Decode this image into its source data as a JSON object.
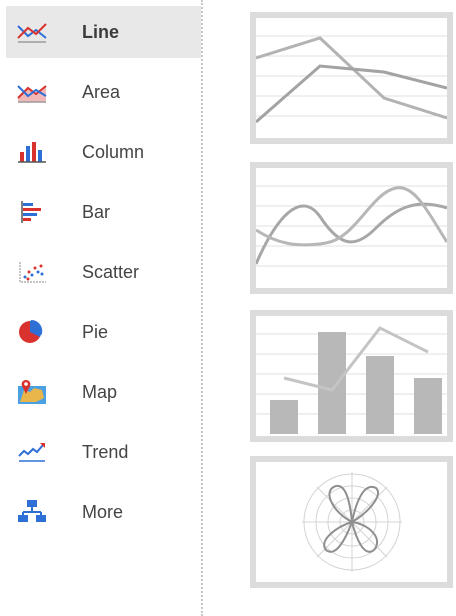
{
  "colors": {
    "accent_red": "#d9322e",
    "accent_blue": "#2e6fd6",
    "selected_bg": "#e8e8e8",
    "thumb_border": "#dcdcdc",
    "chart_gray": "#a7a7a7"
  },
  "sidebar": {
    "items": [
      {
        "label": "Line",
        "icon": "line-chart-icon",
        "selected": true
      },
      {
        "label": "Area",
        "icon": "area-chart-icon",
        "selected": false
      },
      {
        "label": "Column",
        "icon": "column-chart-icon",
        "selected": false
      },
      {
        "label": "Bar",
        "icon": "bar-chart-icon",
        "selected": false
      },
      {
        "label": "Scatter",
        "icon": "scatter-chart-icon",
        "selected": false
      },
      {
        "label": "Pie",
        "icon": "pie-chart-icon",
        "selected": false
      },
      {
        "label": "Map",
        "icon": "map-icon",
        "selected": false
      },
      {
        "label": "Trend",
        "icon": "trend-icon",
        "selected": false
      },
      {
        "label": "More",
        "icon": "hierarchy-icon",
        "selected": false
      }
    ]
  },
  "previews": [
    {
      "name": "line-preview",
      "icon": "line-chart-preview"
    },
    {
      "name": "spline-preview",
      "icon": "spline-chart-preview"
    },
    {
      "name": "column-line-preview",
      "icon": "combo-chart-preview"
    },
    {
      "name": "radar-preview",
      "icon": "radar-chart-preview"
    }
  ]
}
